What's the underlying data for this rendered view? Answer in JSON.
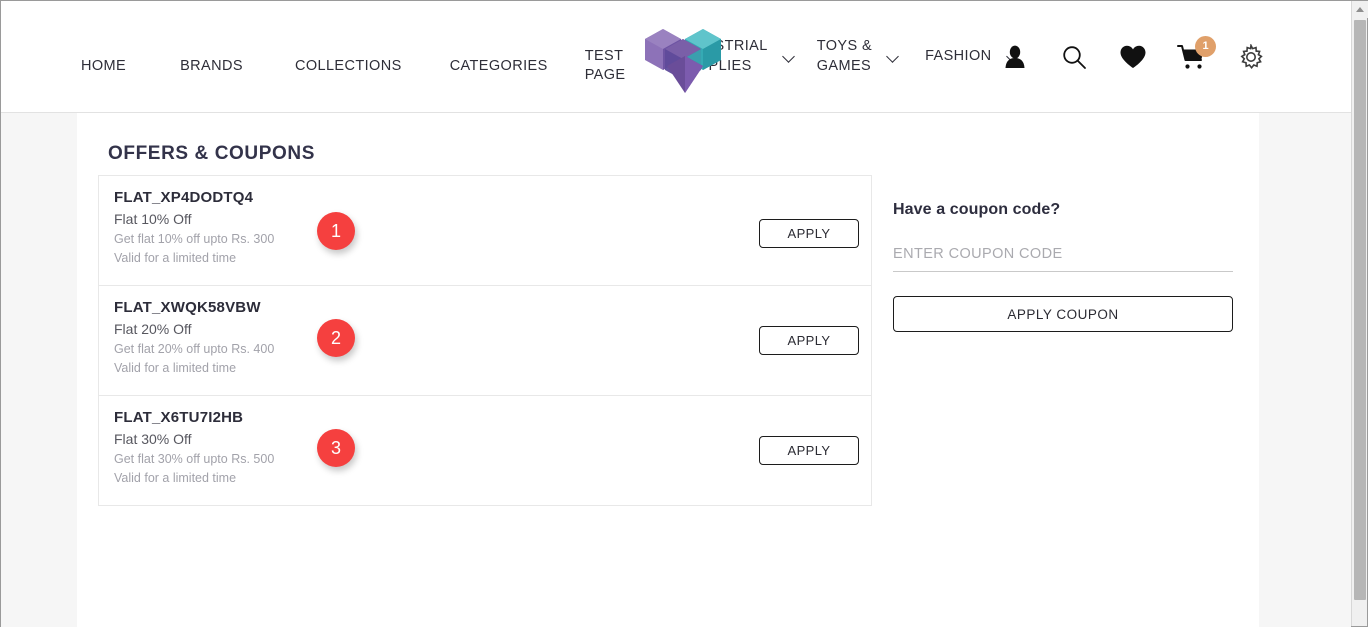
{
  "header": {
    "nav_items": [
      {
        "label": "HOME",
        "has_dropdown": false
      },
      {
        "label": "BRANDS",
        "has_dropdown": false
      },
      {
        "label": "COLLECTIONS",
        "has_dropdown": false
      },
      {
        "label": "CATEGORIES",
        "has_dropdown": false
      },
      {
        "label": "TEST\nPAGE",
        "has_dropdown": false
      },
      {
        "label": "INDUSTRIAL\nSUPPLIES",
        "has_dropdown": true
      },
      {
        "label": "TOYS &\nGAMES",
        "has_dropdown": true
      },
      {
        "label": "FASHION",
        "has_dropdown": true
      }
    ],
    "icons": {
      "account": "user-icon",
      "search": "search-icon",
      "wishlist": "heart-icon",
      "cart": "cart-icon",
      "settings": "gear-icon"
    },
    "cart_count": "1",
    "logo_colors": {
      "purple_light": "#8d72b8",
      "purple_mid": "#7a5fa8",
      "purple_dark": "#6a4d99",
      "teal_light": "#5fc4cb",
      "teal_mid": "#35aab4",
      "teal_dark": "#2a9aa6"
    }
  },
  "main": {
    "section_title": "OFFERS & COUPONS",
    "coupons": [
      {
        "code": "FLAT_XP4DODTQ4",
        "headline": "Flat 10% Off",
        "description": "Get flat 10% off upto Rs. 300",
        "validity": "Valid for a limited time",
        "apply_label": "APPLY",
        "step_number": "1"
      },
      {
        "code": "FLAT_XWQK58VBW",
        "headline": "Flat 20% Off",
        "description": "Get flat 20% off upto Rs. 400",
        "validity": "Valid for a limited time",
        "apply_label": "APPLY",
        "step_number": "2"
      },
      {
        "code": "FLAT_X6TU7I2HB",
        "headline": "Flat 30% Off",
        "description": "Get flat 30% off upto Rs. 500",
        "validity": "Valid for a limited time",
        "apply_label": "APPLY",
        "step_number": "3"
      }
    ],
    "coupon_panel": {
      "title": "Have a coupon code?",
      "input_value": "",
      "input_placeholder": "ENTER COUPON CODE",
      "apply_label": "APPLY COUPON"
    }
  },
  "colors": {
    "badge_red": "#f5403f",
    "cart_badge_orange": "#e0a06a",
    "text_dark": "#2d2d3a",
    "text_muted": "#a2a2aa",
    "page_bg": "#f6f6f6"
  }
}
